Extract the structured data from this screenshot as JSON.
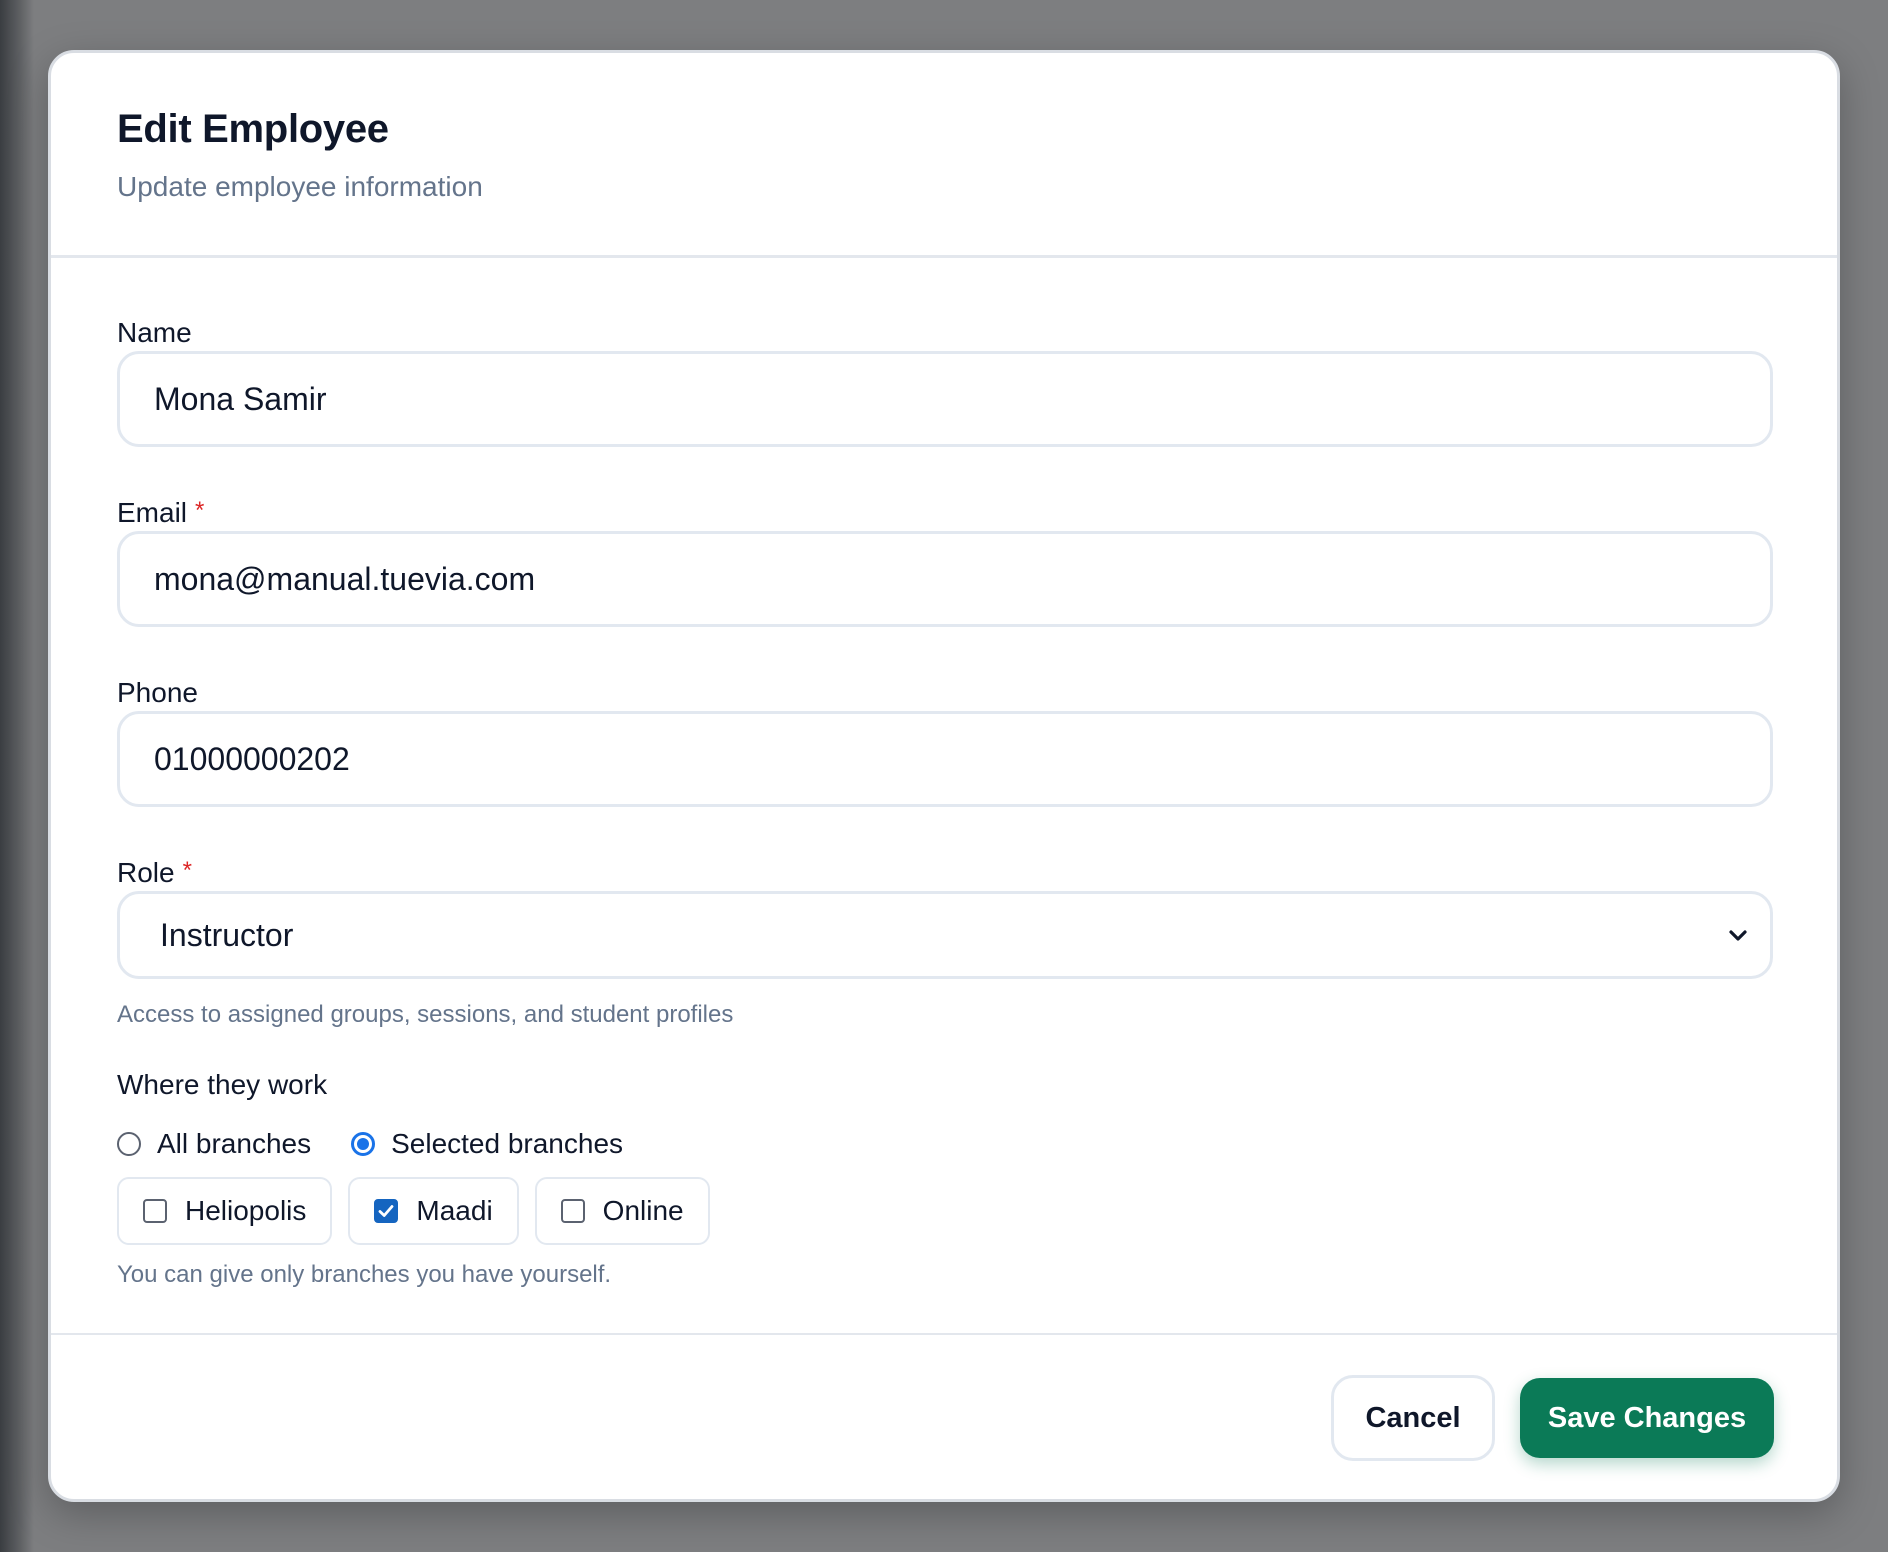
{
  "dialog": {
    "title": "Edit Employee",
    "subtitle": "Update employee information"
  },
  "fields": {
    "name": {
      "label": "Name",
      "value": "Mona Samir"
    },
    "email": {
      "label": "Email",
      "value": "mona@manual.tuevia.com",
      "required_mark": "*"
    },
    "phone": {
      "label": "Phone",
      "value": "01000000202"
    },
    "role": {
      "label": "Role",
      "value": "Instructor",
      "required_mark": "*",
      "hint": "Access to assigned groups, sessions, and student profiles"
    }
  },
  "work_location": {
    "label": "Where they work",
    "options": [
      {
        "label": "All branches",
        "selected": false
      },
      {
        "label": "Selected branches",
        "selected": true
      }
    ],
    "branches": [
      {
        "label": "Heliopolis",
        "checked": false
      },
      {
        "label": "Maadi",
        "checked": true
      },
      {
        "label": "Online",
        "checked": false
      }
    ],
    "hint": "You can give only branches you have yourself."
  },
  "actions": {
    "cancel_label": "Cancel",
    "save_label": "Save Changes"
  },
  "colors": {
    "primary_button": "#0b7a57",
    "radio_accent": "#1a73e8",
    "checkbox_accent": "#1565c0",
    "required": "#dc2626"
  }
}
